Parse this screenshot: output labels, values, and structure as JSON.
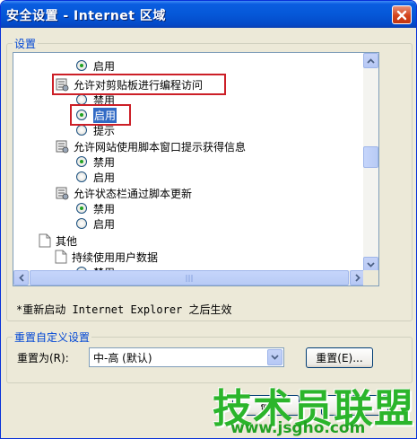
{
  "window": {
    "title": "安全设置 - Internet 区域",
    "close_icon": "close-icon"
  },
  "settings_group": {
    "label": "设置"
  },
  "tree": {
    "rows": [
      {
        "type": "radio",
        "label": "启用",
        "checked": true
      },
      {
        "type": "setting",
        "label": "允许对剪贴板进行编程访问",
        "icon": "settings-scroll-icon"
      },
      {
        "type": "radio",
        "label": "禁用",
        "checked": false
      },
      {
        "type": "radio",
        "label": "启用",
        "checked": true,
        "selected": true
      },
      {
        "type": "radio",
        "label": "提示",
        "checked": false
      },
      {
        "type": "setting",
        "label": "允许网站使用脚本窗口提示获得信息",
        "icon": "settings-scroll-icon"
      },
      {
        "type": "radio",
        "label": "禁用",
        "checked": true
      },
      {
        "type": "radio",
        "label": "启用",
        "checked": false
      },
      {
        "type": "setting",
        "label": "允许状态栏通过脚本更新",
        "icon": "settings-scroll-icon"
      },
      {
        "type": "radio",
        "label": "禁用",
        "checked": true
      },
      {
        "type": "radio",
        "label": "启用",
        "checked": false
      },
      {
        "type": "category",
        "label": "其他",
        "icon": "document-icon"
      },
      {
        "type": "setting",
        "label": "持续使用用户数据",
        "icon": "document-icon"
      },
      {
        "type": "radio",
        "label": "禁用",
        "checked": false
      },
      {
        "type": "radio",
        "label": "启用",
        "checked": false
      }
    ]
  },
  "note": "*重新启动 Internet Explorer 之后生效",
  "reset_group": {
    "label": "重置自定义设置",
    "reset_to_label": "重置为(R):",
    "select_value": "中-高 (默认)",
    "reset_button": "重置(E)..."
  },
  "footer": {
    "ok_button": "确"
  },
  "watermark": {
    "text": "技术员联盟",
    "url": "www.jsgho.com"
  },
  "colors": {
    "title_bar": "#0558d8",
    "highlight_box": "#cc1f27",
    "selection": "#316ac5",
    "radio_checked": "#21a121",
    "watermark": "#2bb52b"
  }
}
